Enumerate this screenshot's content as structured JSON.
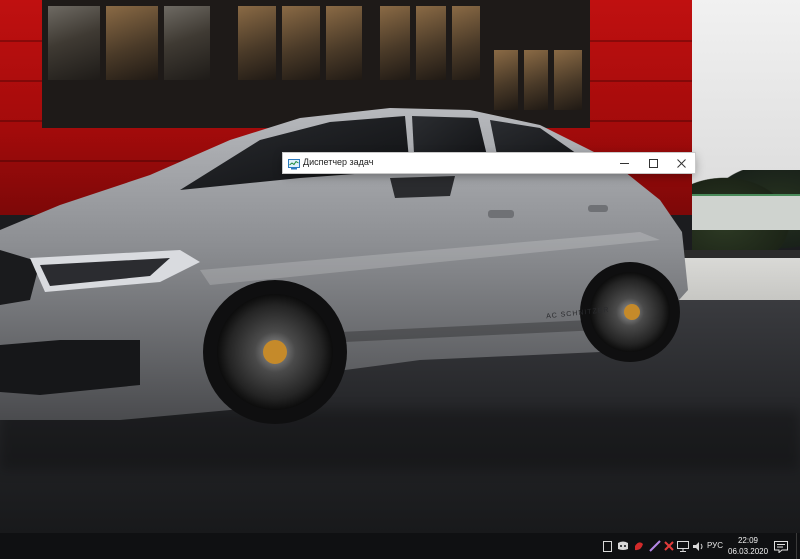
{
  "task_manager": {
    "title": "Диспетчер задач",
    "icon": "task-manager-icon",
    "controls": [
      "minimize-icon",
      "maximize-icon",
      "close-icon"
    ]
  },
  "taskbar": {
    "tray_icons": [
      "tablet-icon",
      "discord-icon",
      "antivirus-icon",
      "pen-icon",
      "network-error-icon",
      "display-icon",
      "volume-icon"
    ],
    "language": "РУС",
    "time": "22:09",
    "date": "06.03.2020",
    "notification_icon": "action-center-icon"
  },
  "wallpaper": {
    "subject": "car-wallpaper",
    "car_badge_text": "AC SCHNITZER",
    "colors": {
      "building": "#b30d0d",
      "car": "#8e9094",
      "road": "#26272a"
    }
  }
}
